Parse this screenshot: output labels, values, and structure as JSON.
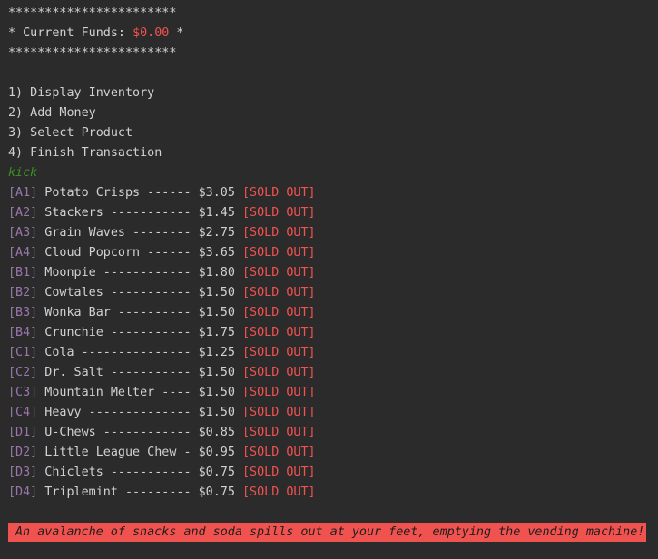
{
  "header": {
    "stars": "***********************",
    "funds_prefix": "* Current Funds: ",
    "funds_value": "$0.00",
    "funds_suffix": " *"
  },
  "menu": [
    "1) Display Inventory",
    "2) Add Money",
    "3) Select Product",
    "4) Finish Transaction"
  ],
  "command": "kick",
  "inventory": [
    {
      "slot": "[A1]",
      "text": " Potato Crisps ------ $3.05 ",
      "status": "[SOLD OUT]"
    },
    {
      "slot": "[A2]",
      "text": " Stackers ----------- $1.45 ",
      "status": "[SOLD OUT]"
    },
    {
      "slot": "[A3]",
      "text": " Grain Waves -------- $2.75 ",
      "status": "[SOLD OUT]"
    },
    {
      "slot": "[A4]",
      "text": " Cloud Popcorn ------ $3.65 ",
      "status": "[SOLD OUT]"
    },
    {
      "slot": "[B1]",
      "text": " Moonpie ------------ $1.80 ",
      "status": "[SOLD OUT]"
    },
    {
      "slot": "[B2]",
      "text": " Cowtales ----------- $1.50 ",
      "status": "[SOLD OUT]"
    },
    {
      "slot": "[B3]",
      "text": " Wonka Bar ---------- $1.50 ",
      "status": "[SOLD OUT]"
    },
    {
      "slot": "[B4]",
      "text": " Crunchie ----------- $1.75 ",
      "status": "[SOLD OUT]"
    },
    {
      "slot": "[C1]",
      "text": " Cola --------------- $1.25 ",
      "status": "[SOLD OUT]"
    },
    {
      "slot": "[C2]",
      "text": " Dr. Salt ----------- $1.50 ",
      "status": "[SOLD OUT]"
    },
    {
      "slot": "[C3]",
      "text": " Mountain Melter ---- $1.50 ",
      "status": "[SOLD OUT]"
    },
    {
      "slot": "[C4]",
      "text": " Heavy -------------- $1.50 ",
      "status": "[SOLD OUT]"
    },
    {
      "slot": "[D1]",
      "text": " U-Chews ------------ $0.85 ",
      "status": "[SOLD OUT]"
    },
    {
      "slot": "[D2]",
      "text": " Little League Chew - $0.95 ",
      "status": "[SOLD OUT]"
    },
    {
      "slot": "[D3]",
      "text": " Chiclets ----------- $0.75 ",
      "status": "[SOLD OUT]"
    },
    {
      "slot": "[D4]",
      "text": " Triplemint --------- $0.75 ",
      "status": "[SOLD OUT]"
    }
  ],
  "banner": "An avalanche of snacks and soda spills out at your feet, emptying the vending machine!",
  "colors": {
    "background": "#2b2b2b",
    "text": "#cfd1d4",
    "accent_red": "#f0524f",
    "slot_purple": "#9876aa",
    "command_green": "#3e8f24"
  }
}
